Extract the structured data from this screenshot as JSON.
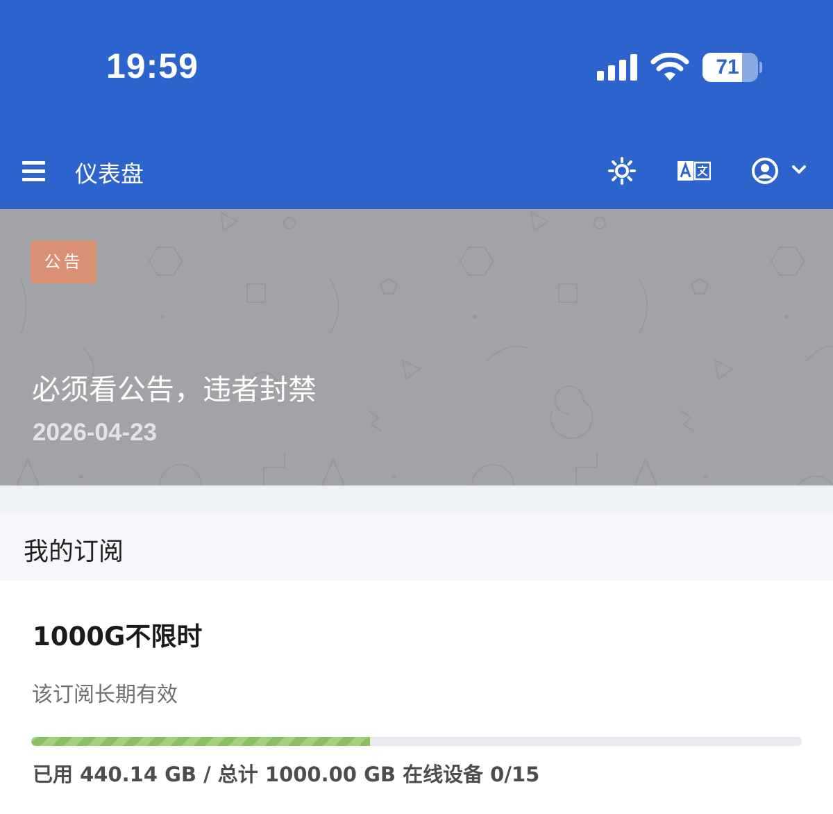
{
  "status_bar": {
    "time": "19:59",
    "battery": "71",
    "battery_level": 0.71
  },
  "app_bar": {
    "title": "仪表盘",
    "icons": [
      "menu-icon",
      "theme-icon",
      "language-icon",
      "user-icon",
      "chevron-down-icon"
    ]
  },
  "notice": {
    "badge": "公告",
    "title": "必须看公告，违者封禁",
    "date": "2026-04-23"
  },
  "subscription": {
    "header": "我的订阅",
    "plan_name": "1000G不限时",
    "validity": "该订阅长期有效",
    "usage_fraction": 0.44,
    "usage_text": "已用 440.14 GB / 总计 1000.00 GB 在线设备 0/15"
  },
  "colors": {
    "app_bar": "#2c63cc",
    "notice_bg": "#a2a3a6",
    "badge": "#db8f74",
    "progress": "#8cbf63"
  }
}
